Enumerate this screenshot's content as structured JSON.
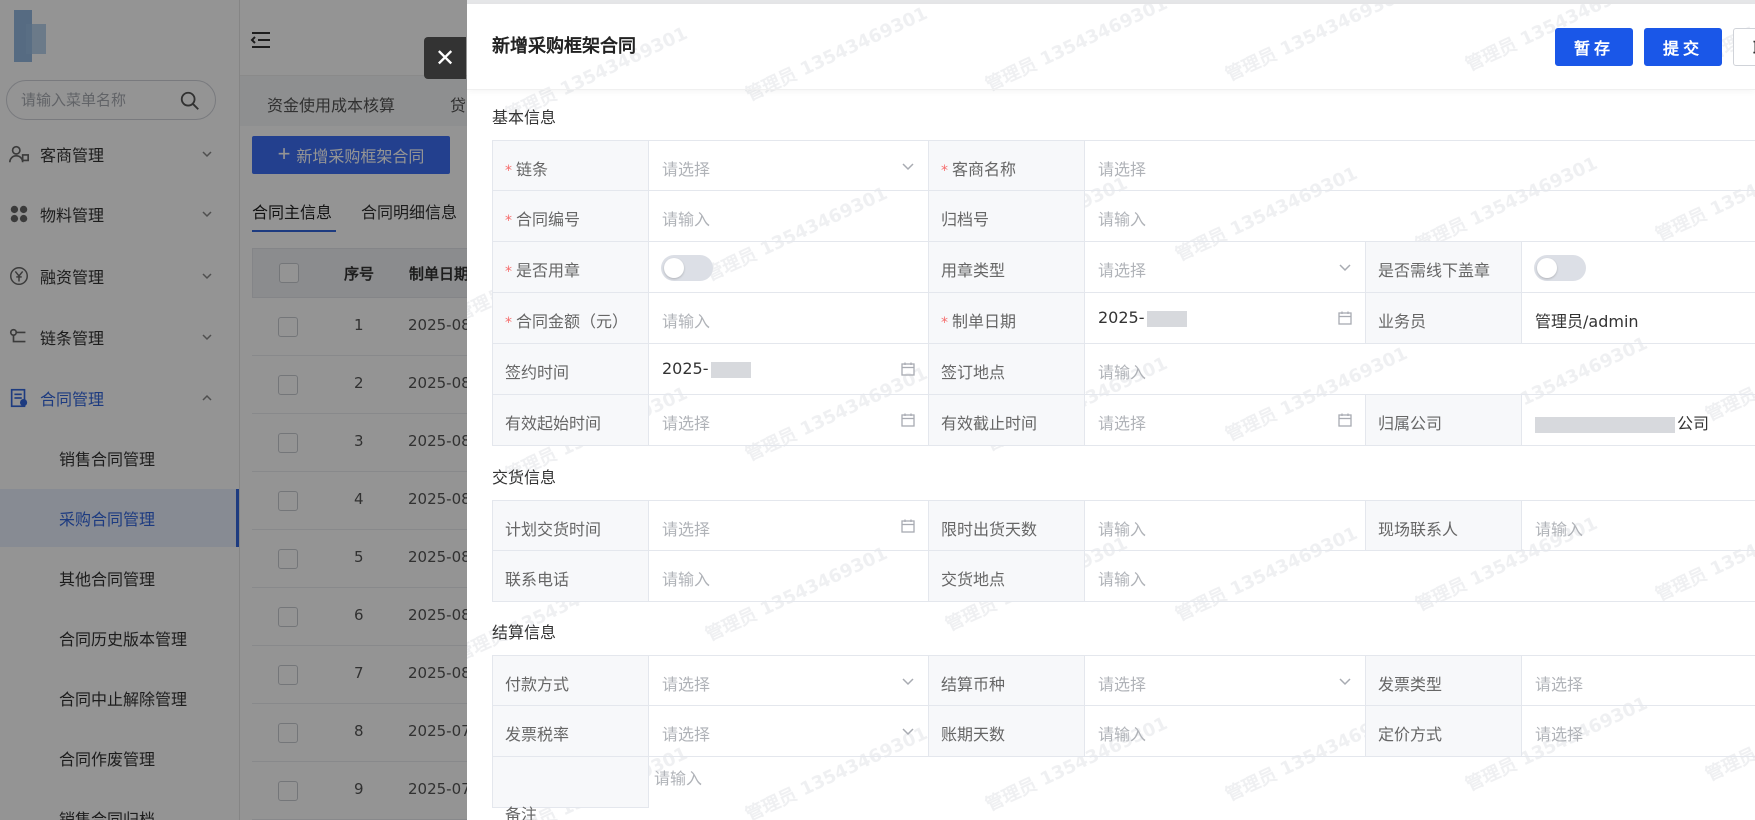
{
  "sidebar": {
    "search_placeholder": "请输入菜单名称",
    "menus": [
      {
        "label": "客商管理"
      },
      {
        "label": "物料管理"
      },
      {
        "label": "融资管理"
      },
      {
        "label": "链条管理"
      },
      {
        "label": "合同管理"
      }
    ],
    "sub_items": [
      {
        "label": "销售合同管理"
      },
      {
        "label": "采购合同管理"
      },
      {
        "label": "其他合同管理"
      },
      {
        "label": "合同历史版本管理"
      },
      {
        "label": "合同中止解除管理"
      },
      {
        "label": "合同作废管理"
      },
      {
        "label": "销售合同归档"
      }
    ]
  },
  "tabs": [
    "资金使用成本核算",
    "贷"
  ],
  "list": {
    "add_button": "新增采购框架合同",
    "subtabs": [
      "合同主信息",
      "合同明细信息"
    ],
    "headers": {
      "index": "序号",
      "date": "制单日期"
    },
    "rows": [
      {
        "index": "1",
        "date": "2025-08"
      },
      {
        "index": "2",
        "date": "2025-08"
      },
      {
        "index": "3",
        "date": "2025-08"
      },
      {
        "index": "4",
        "date": "2025-08"
      },
      {
        "index": "5",
        "date": "2025-08"
      },
      {
        "index": "6",
        "date": "2025-08"
      },
      {
        "index": "7",
        "date": "2025-08"
      },
      {
        "index": "8",
        "date": "2025-07"
      },
      {
        "index": "9",
        "date": "2025-07"
      }
    ]
  },
  "drawer": {
    "title": "新增采购框架合同",
    "buttons": {
      "save": "暂存",
      "submit": "提交",
      "third": "取"
    },
    "sections": {
      "basic": "基本信息",
      "delivery": "交货信息",
      "settlement": "结算信息"
    },
    "placeholders": {
      "select": "请选择",
      "input": "请输入"
    },
    "fields": {
      "chain": "链条",
      "customer_name": "客商名称",
      "contract_no": "合同编号",
      "archive_no": "归档号",
      "use_seal": "是否用章",
      "seal_type": "用章类型",
      "offline_seal": "是否需线下盖章",
      "contract_amount": "合同金额（元）",
      "create_date": "制单日期",
      "create_date_value": "2025-",
      "salesman": "业务员",
      "salesman_value": "管理员/admin",
      "sign_time": "签约时间",
      "sign_time_value": "2025-",
      "sign_place": "签订地点",
      "valid_start": "有效起始时间",
      "valid_end": "有效截止时间",
      "company": "归属公司",
      "company_value": "公司",
      "plan_delivery_time": "计划交货时间",
      "ship_days": "限时出货天数",
      "site_contact": "现场联系人",
      "phone": "联系电话",
      "delivery_place": "交货地点",
      "payment_method": "付款方式",
      "currency": "结算币种",
      "invoice_type": "发票类型",
      "tax_rate": "发票税率",
      "account_days": "账期天数",
      "pricing_method": "定价方式",
      "remark": "备注"
    }
  },
  "watermark": "管理员 13543469301"
}
